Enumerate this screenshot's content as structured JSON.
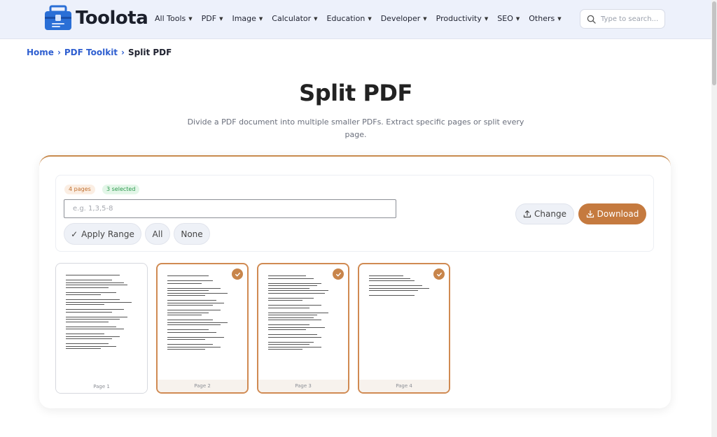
{
  "header": {
    "logo_text": "Toolota",
    "nav": [
      {
        "label": "All Tools"
      },
      {
        "label": "PDF"
      },
      {
        "label": "Image"
      },
      {
        "label": "Calculator"
      },
      {
        "label": "Education"
      },
      {
        "label": "Developer"
      },
      {
        "label": "Productivity"
      },
      {
        "label": "SEO"
      },
      {
        "label": "Others"
      }
    ],
    "search_placeholder": "Type to search..."
  },
  "breadcrumb": {
    "items": [
      "Home",
      "PDF Toolkit"
    ],
    "current": "Split PDF"
  },
  "page": {
    "title": "Split PDF",
    "description": "Divide a PDF document into multiple smaller PDFs. Extract specific pages or split every page."
  },
  "tool": {
    "page_count_badge": "4 pages",
    "selected_badge": "3 selected",
    "range_placeholder": "e.g. 1,3,5-8",
    "apply_range_label": "Apply Range",
    "all_label": "All",
    "none_label": "None",
    "change_label": "Change",
    "download_label": "Download"
  },
  "pages": [
    {
      "label": "Page 1",
      "selected": false
    },
    {
      "label": "Page 2",
      "selected": true
    },
    {
      "label": "Page 3",
      "selected": true
    },
    {
      "label": "Page 4",
      "selected": true
    }
  ],
  "colors": {
    "accent": "#c57a3f",
    "link": "#2f5fd0",
    "header_bg": "#edf1fb"
  }
}
